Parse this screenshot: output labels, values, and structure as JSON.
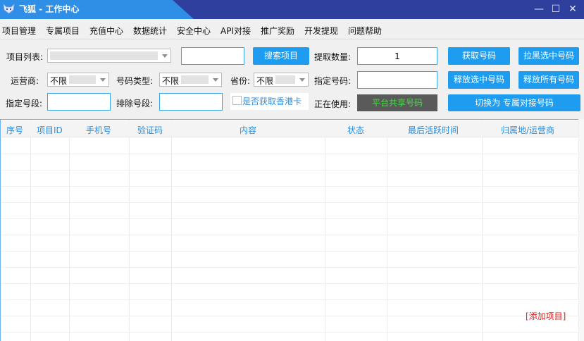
{
  "window": {
    "title": "飞狐 - 工作中心",
    "controls": {
      "minimize": "—",
      "maximize": "☐",
      "close": "✕"
    }
  },
  "menu": [
    "项目管理",
    "专属项目",
    "充值中心",
    "数据统计",
    "安全中心",
    "API对接",
    "推广奖励",
    "开发提现",
    "问题帮助"
  ],
  "form": {
    "project_list_label": "项目列表:",
    "search_button": "搜索项目",
    "fetch_count_label": "提取数量:",
    "fetch_count_value": "1",
    "get_number_button": "获取号码",
    "blacklist_button": "拉黑选中号码",
    "carrier_label": "运营商:",
    "carrier_value": "不限",
    "number_type_label": "号码类型:",
    "number_type_value": "不限",
    "province_label": "省份:",
    "province_value": "不限",
    "specify_number_label": "指定号码:",
    "release_selected_button": "释放选中号码",
    "release_all_button": "释放所有号码",
    "specify_prefix_label": "指定号段:",
    "exclude_prefix_label": "排除号段:",
    "hk_checkbox_label": "是否获取香港卡",
    "in_use_label": "正在使用:",
    "platform_button": "平台共享号码",
    "switch_button": "切换为 专属对接号码"
  },
  "table": {
    "columns": [
      "序号",
      "项目ID",
      "手机号",
      "验证码",
      "内容",
      "状态",
      "最后活跃时间",
      "归属地/运营商"
    ],
    "add_link": "[添加项目]"
  }
}
